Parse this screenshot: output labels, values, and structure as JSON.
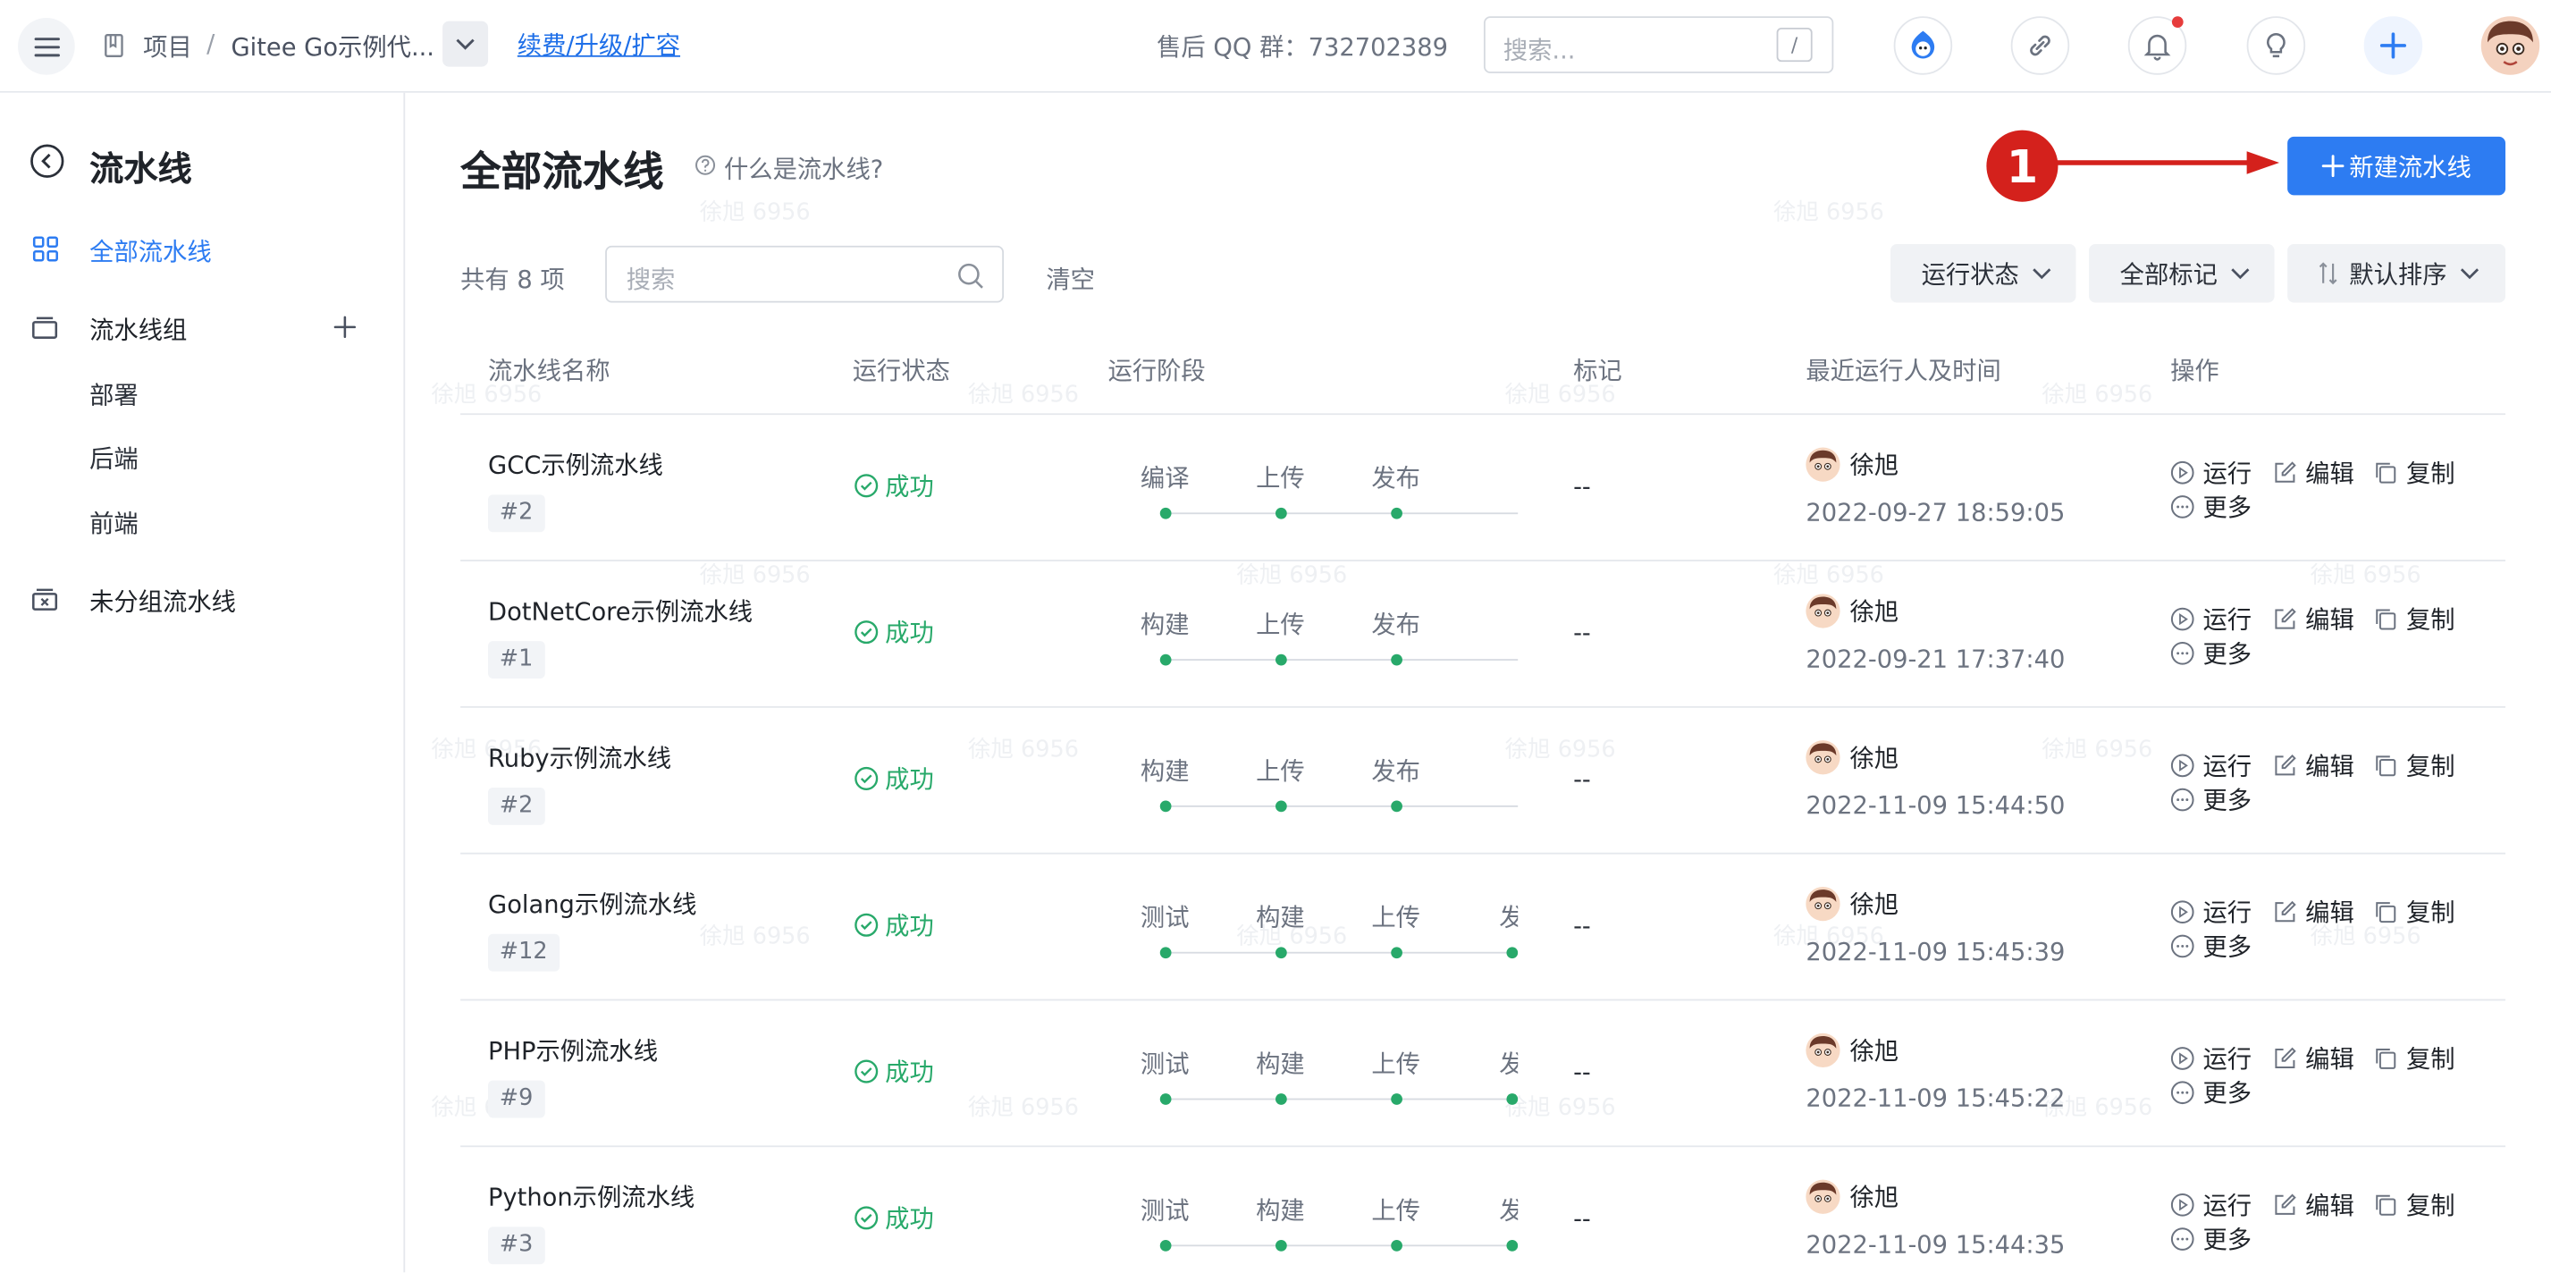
{
  "topbar": {
    "breadcrumb_root": "项目",
    "breadcrumb_sep": "/",
    "breadcrumb_project": "Gitee Go示例代...",
    "renew_link": "续费/升级/扩容",
    "support_qq": "售后 QQ 群：732702389",
    "search_placeholder": "搜索...",
    "search_shortcut": "/"
  },
  "sidebar": {
    "title": "流水线",
    "all_pipelines": "全部流水线",
    "groups_label": "流水线组",
    "groups": [
      "部署",
      "后端",
      "前端"
    ],
    "ungrouped": "未分组流水线"
  },
  "main": {
    "title": "全部流水线",
    "help_text": "什么是流水线?",
    "new_button": "新建流水线",
    "annotation_number": "1",
    "count_text": "共有 8 项",
    "search_placeholder": "搜索",
    "clear_label": "清空",
    "filter_status": "运行状态",
    "filter_tags": "全部标记",
    "sort_label": "默认排序"
  },
  "table": {
    "headers": [
      "流水线名称",
      "运行状态",
      "运行阶段",
      "标记",
      "最近运行人及时间",
      "操作"
    ],
    "actions": {
      "run": "运行",
      "edit": "编辑",
      "copy": "复制",
      "more": "更多"
    },
    "rows": [
      {
        "name": "GCC示例流水线",
        "build": "#2",
        "status": "成功",
        "stages": [
          "编译",
          "上传",
          "发布"
        ],
        "mark": "--",
        "user": "徐旭",
        "time": "2022-09-27 18:59:05"
      },
      {
        "name": "DotNetCore示例流水线",
        "build": "#1",
        "status": "成功",
        "stages": [
          "构建",
          "上传",
          "发布"
        ],
        "mark": "--",
        "user": "徐旭",
        "time": "2022-09-21 17:37:40"
      },
      {
        "name": "Ruby示例流水线",
        "build": "#2",
        "status": "成功",
        "stages": [
          "构建",
          "上传",
          "发布"
        ],
        "mark": "--",
        "user": "徐旭",
        "time": "2022-11-09 15:44:50"
      },
      {
        "name": "Golang示例流水线",
        "build": "#12",
        "status": "成功",
        "stages": [
          "测试",
          "构建",
          "上传",
          "发"
        ],
        "mark": "--",
        "user": "徐旭",
        "time": "2022-11-09 15:45:39"
      },
      {
        "name": "PHP示例流水线",
        "build": "#9",
        "status": "成功",
        "stages": [
          "测试",
          "构建",
          "上传",
          "发"
        ],
        "mark": "--",
        "user": "徐旭",
        "time": "2022-11-09 15:45:22"
      },
      {
        "name": "Python示例流水线",
        "build": "#3",
        "status": "成功",
        "stages": [
          "测试",
          "构建",
          "上传",
          "发"
        ],
        "mark": "--",
        "user": "徐旭",
        "time": "2022-11-09 15:44:35"
      }
    ]
  },
  "watermark": "徐旭 6956",
  "colors": {
    "accent": "#2d7cf2",
    "success": "#28a96a",
    "annotation": "#d4211c"
  }
}
